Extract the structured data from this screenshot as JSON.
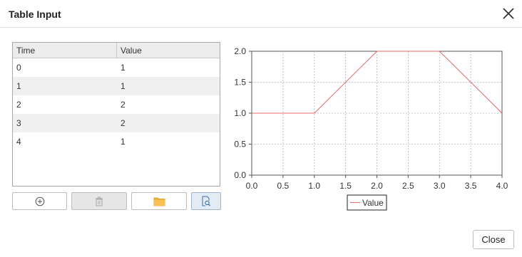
{
  "dialog": {
    "title": "Table Input",
    "close_button_label": "Close"
  },
  "table": {
    "columns": [
      "Time",
      "Value"
    ],
    "rows": [
      [
        "0",
        "1"
      ],
      [
        "1",
        "1"
      ],
      [
        "2",
        "2"
      ],
      [
        "3",
        "2"
      ],
      [
        "4",
        "1"
      ]
    ]
  },
  "toolbar": {
    "buttons": [
      {
        "name": "add-row",
        "icon": "add-circle-icon",
        "state": "enabled"
      },
      {
        "name": "delete-row",
        "icon": "trash-icon",
        "state": "disabled"
      },
      {
        "name": "open-file",
        "icon": "folder-icon",
        "state": "enabled"
      },
      {
        "name": "preview",
        "icon": "document-search-icon",
        "state": "active"
      }
    ]
  },
  "chart_data": {
    "type": "line",
    "x": [
      0,
      1,
      2,
      3,
      4
    ],
    "series": [
      {
        "name": "Value",
        "values": [
          1,
          1,
          2,
          2,
          1
        ],
        "color": "#e86a6a"
      }
    ],
    "xlim": [
      0,
      4
    ],
    "ylim": [
      0,
      2
    ],
    "xticks": [
      "0.0",
      "0.5",
      "1.0",
      "1.5",
      "2.0",
      "2.5",
      "3.0",
      "3.5",
      "4.0"
    ],
    "yticks": [
      "0.0",
      "0.5",
      "1.0",
      "1.5",
      "2.0"
    ],
    "grid": true,
    "grid_style": "dashed",
    "legend_position": "bottom-center"
  },
  "colors": {
    "line": "#e86a6a",
    "folder": "#f5b233",
    "icon_blue": "#3d6fa8"
  }
}
